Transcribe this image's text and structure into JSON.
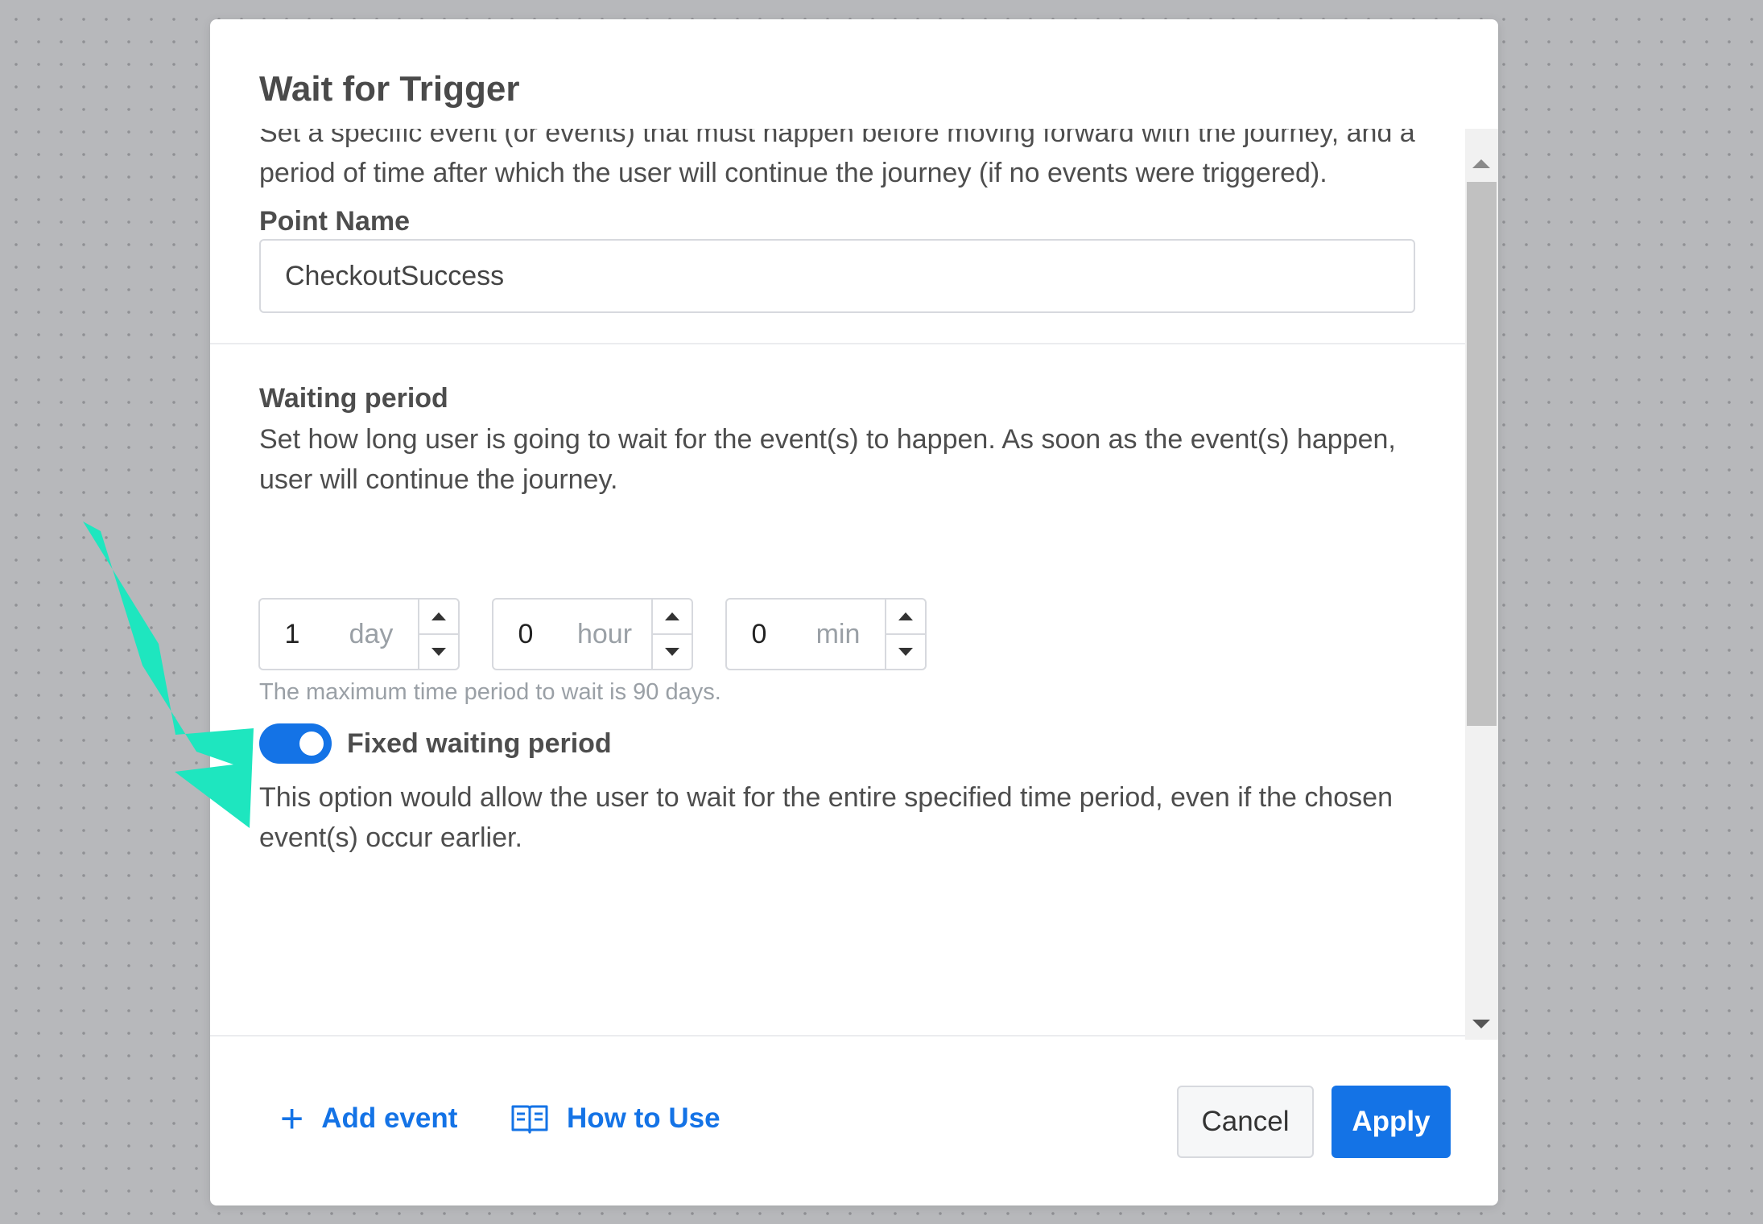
{
  "modal": {
    "title": "Wait for Trigger",
    "description": "Set a specific event (or events) that must happen before moving forward with the journey, and a period of time after which the user will continue the journey (if no events were triggered).",
    "point_name": {
      "label": "Point Name",
      "value": "CheckoutSuccess"
    },
    "waiting_period": {
      "label": "Waiting period",
      "description": "Set how long user is going to wait for the event(s) to happen. As soon as the event(s) happen, user will continue the journey.",
      "days": {
        "value": "1",
        "unit": "day"
      },
      "hours": {
        "value": "0",
        "unit": "hour"
      },
      "minutes": {
        "value": "0",
        "unit": "min"
      },
      "hint": "The maximum time period to wait is 90 days."
    },
    "fixed_waiting": {
      "enabled": true,
      "label": "Fixed waiting period",
      "description": "This option would allow the user to wait for the entire specified time period, even if the chosen event(s) occur earlier."
    },
    "footer": {
      "add_event": "Add event",
      "how_to_use": "How to Use",
      "cancel": "Cancel",
      "apply": "Apply"
    }
  },
  "colors": {
    "accent": "#1473e6",
    "annotation_arrow": "#1ee6bf"
  },
  "icons": {
    "add_event": "plus-icon",
    "how_to_use": "book-icon"
  }
}
